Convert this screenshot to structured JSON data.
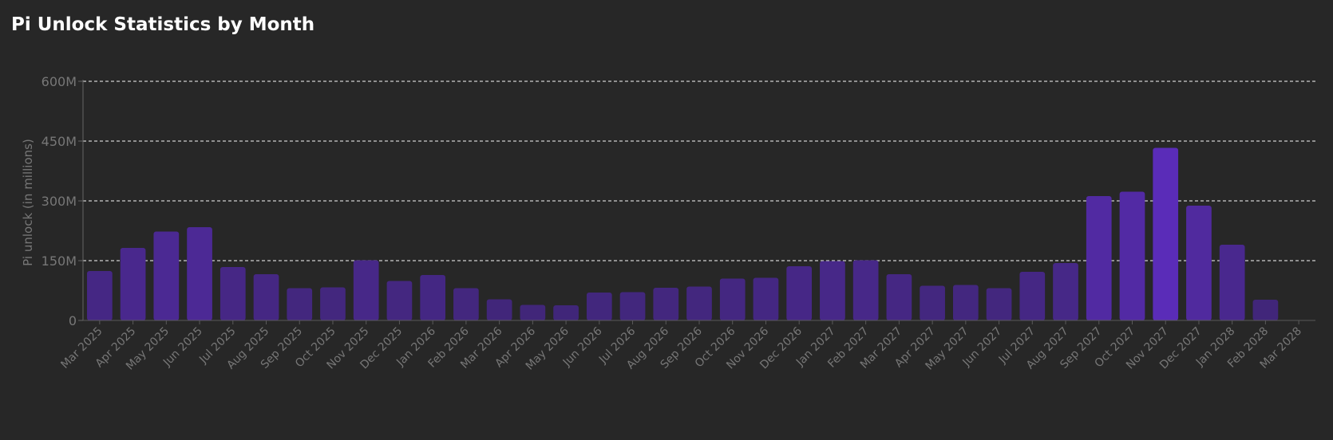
{
  "page": {
    "title": "Pi Unlock Statistics by Month"
  },
  "colors": {
    "background": "#272727",
    "bar_low": "#45287f",
    "bar_high": "#5a2cb8",
    "grid": "#cfcfcf",
    "axis_text": "#777777"
  },
  "chart_data": {
    "type": "bar",
    "title": "Pi Unlock Statistics by Month",
    "xlabel": "",
    "ylabel": "Pi unlock (in millions)",
    "ylim": [
      0,
      600
    ],
    "y_ticks": [
      0,
      150,
      300,
      450,
      600
    ],
    "y_tick_labels": [
      "0",
      "150M",
      "300M",
      "450M",
      "600M"
    ],
    "grid": true,
    "legend": "none",
    "categories": [
      "Mar 2025",
      "Apr 2025",
      "May 2025",
      "Jun 2025",
      "Jul 2025",
      "Aug 2025",
      "Sep 2025",
      "Oct 2025",
      "Nov 2025",
      "Dec 2025",
      "Jan 2026",
      "Feb 2026",
      "Mar 2026",
      "Apr 2026",
      "May 2026",
      "Jun 2026",
      "Jul 2026",
      "Aug 2026",
      "Sep 2026",
      "Oct 2026",
      "Nov 2026",
      "Dec 2026",
      "Jan 2027",
      "Feb 2027",
      "Mar 2027",
      "Apr 2027",
      "May 2027",
      "Jun 2027",
      "Jul 2027",
      "Aug 2027",
      "Sep 2027",
      "Oct 2027",
      "Nov 2027",
      "Dec 2027",
      "Jan 2028",
      "Feb 2028",
      "Mar 2028"
    ],
    "values": [
      124,
      182,
      223,
      234,
      134,
      116,
      81,
      83,
      151,
      99,
      114,
      81,
      53,
      39,
      38,
      70,
      71,
      82,
      85,
      105,
      107,
      136,
      149,
      151,
      116,
      87,
      89,
      81,
      122,
      144,
      312,
      323,
      433,
      288,
      190,
      52,
      1
    ]
  }
}
